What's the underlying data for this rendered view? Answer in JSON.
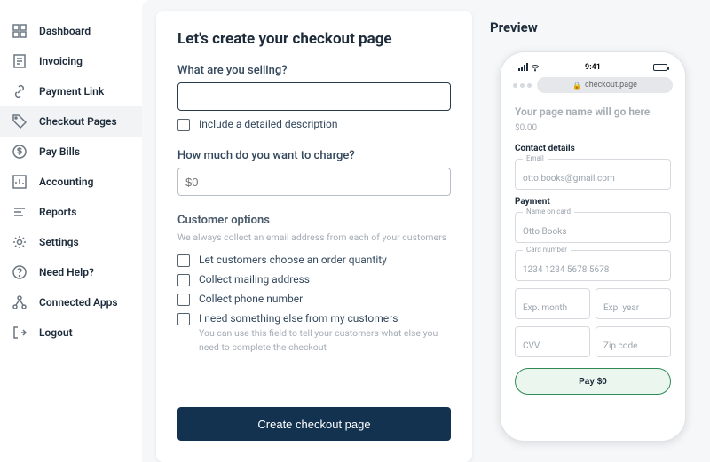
{
  "sidebar": {
    "items": [
      {
        "label": "Dashboard"
      },
      {
        "label": "Invoicing"
      },
      {
        "label": "Payment Link"
      },
      {
        "label": "Checkout Pages"
      },
      {
        "label": "Pay Bills"
      },
      {
        "label": "Accounting"
      },
      {
        "label": "Reports"
      },
      {
        "label": "Settings"
      },
      {
        "label": "Need Help?"
      },
      {
        "label": "Connected Apps"
      },
      {
        "label": "Logout"
      }
    ],
    "active_index": 3
  },
  "form": {
    "title": "Let's create your checkout page",
    "selling": {
      "label": "What are you selling?",
      "value": "",
      "include_description_label": "Include a detailed description"
    },
    "charge": {
      "label": "How much do you want to charge?",
      "placeholder": "$0"
    },
    "customer_options": {
      "title": "Customer options",
      "subtitle": "We always collect an email address from each of your customers",
      "opts": [
        {
          "label": "Let customers choose an order quantity"
        },
        {
          "label": "Collect mailing address"
        },
        {
          "label": "Collect phone number"
        },
        {
          "label": "I need something else from my customers",
          "helper": "You can use this field to tell your customers what else you need to complete the checkout"
        }
      ]
    },
    "submit_label": "Create checkout page"
  },
  "preview": {
    "heading": "Preview",
    "status_time": "9:41",
    "url": "checkout.page",
    "page_name_placeholder": "Your page name will go here",
    "price": "$0.00",
    "contact": {
      "title": "Contact details",
      "email": {
        "label": "Email",
        "placeholder": "otto.books@gmail.com"
      }
    },
    "payment": {
      "title": "Payment",
      "name_on_card": {
        "label": "Name on card",
        "placeholder": "Otto Books"
      },
      "card_number": {
        "label": "Card number",
        "placeholder": "1234 1234 5678 5678"
      },
      "exp_month": {
        "label": "",
        "placeholder": "Exp. month"
      },
      "exp_year": {
        "label": "",
        "placeholder": "Exp. year"
      },
      "cvv": {
        "label": "",
        "placeholder": "CVV"
      },
      "zip": {
        "label": "",
        "placeholder": "Zip code"
      }
    },
    "pay_button_label": "Pay $0"
  }
}
